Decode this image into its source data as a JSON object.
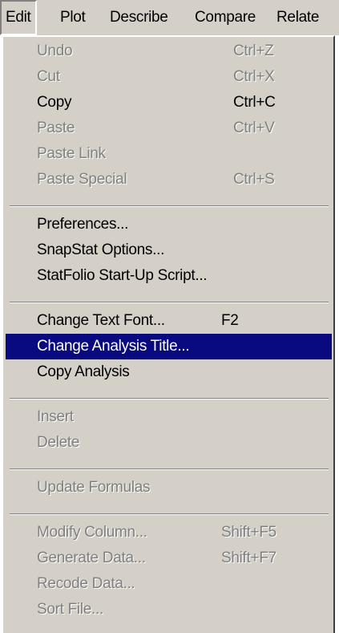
{
  "menubar": {
    "items": [
      {
        "label": "Edit"
      },
      {
        "label": "Plot"
      },
      {
        "label": "Describe"
      },
      {
        "label": "Compare"
      },
      {
        "label": "Relate"
      }
    ]
  },
  "edit_menu": {
    "groups": [
      [
        {
          "label": "Undo",
          "shortcut": "Ctrl+Z",
          "enabled": false
        },
        {
          "label": "Cut",
          "shortcut": "Ctrl+X",
          "enabled": false
        },
        {
          "label": "Copy",
          "shortcut": "Ctrl+C",
          "enabled": true
        },
        {
          "label": "Paste",
          "shortcut": "Ctrl+V",
          "enabled": false
        },
        {
          "label": "Paste Link",
          "shortcut": "",
          "enabled": false
        },
        {
          "label": "Paste Special",
          "shortcut": "Ctrl+S",
          "enabled": false
        }
      ],
      [
        {
          "label": "Preferences...",
          "shortcut": "",
          "enabled": true
        },
        {
          "label": "SnapStat Options...",
          "shortcut": "",
          "enabled": true
        },
        {
          "label": "StatFolio Start-Up Script...",
          "shortcut": "",
          "enabled": true
        }
      ],
      [
        {
          "label": "Change Text Font...",
          "shortcut": "F2",
          "enabled": true
        },
        {
          "label": "Change Analysis Title...",
          "shortcut": "",
          "enabled": true,
          "highlighted": true
        },
        {
          "label": "Copy Analysis",
          "shortcut": "",
          "enabled": true
        }
      ],
      [
        {
          "label": "Insert",
          "shortcut": "",
          "enabled": false
        },
        {
          "label": "Delete",
          "shortcut": "",
          "enabled": false
        }
      ],
      [
        {
          "label": "Update Formulas",
          "shortcut": "",
          "enabled": false
        }
      ],
      [
        {
          "label": "Modify Column...",
          "shortcut": "Shift+F5",
          "enabled": false
        },
        {
          "label": "Generate Data...",
          "shortcut": "Shift+F7",
          "enabled": false
        },
        {
          "label": "Recode Data...",
          "shortcut": "",
          "enabled": false
        },
        {
          "label": "Sort File...",
          "shortcut": "",
          "enabled": false
        }
      ]
    ]
  },
  "colors": {
    "menu_background": "#d4d0c8",
    "highlight_background": "#0a0a80",
    "highlight_text": "#ffffff",
    "disabled_text": "#808080"
  }
}
